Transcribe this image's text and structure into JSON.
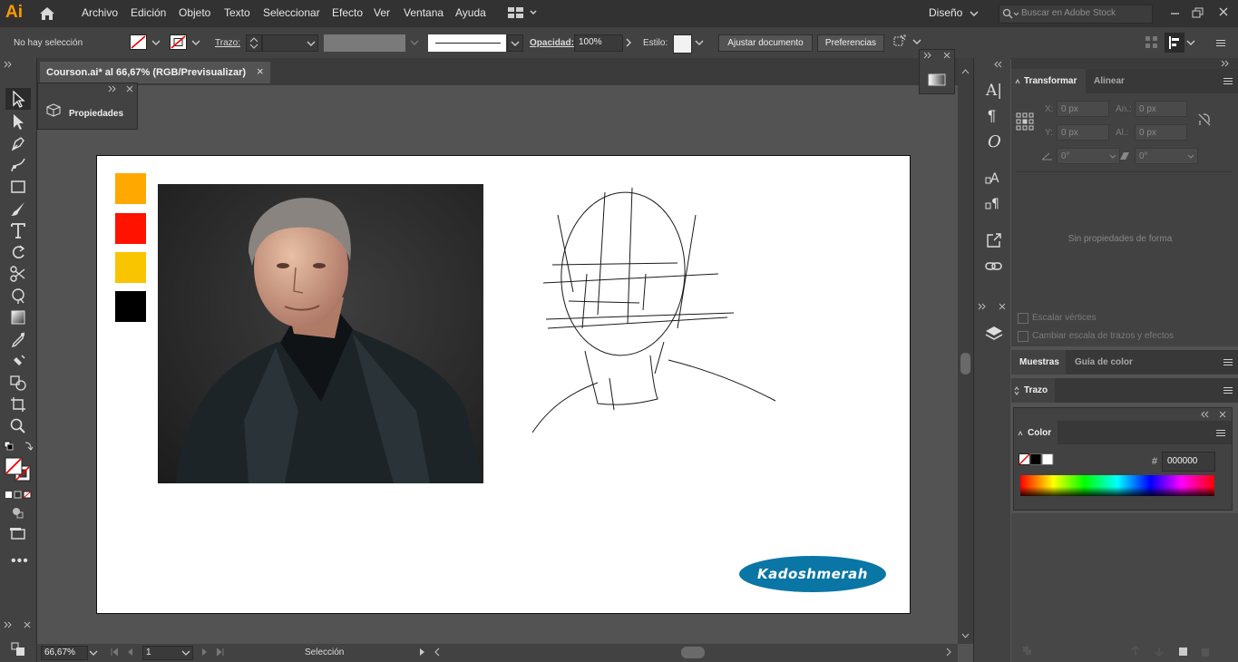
{
  "app": {
    "logo": "Ai",
    "menu": [
      "Archivo",
      "Edición",
      "Objeto",
      "Texto",
      "Seleccionar",
      "Efecto",
      "Ver",
      "Ventana",
      "Ayuda"
    ],
    "workspace": "Diseño",
    "stock_search_placeholder": "Buscar en Adobe Stock"
  },
  "control_bar": {
    "selection_status": "No hay selección",
    "stroke_label": "Trazo:",
    "opacity_label": "Opacidad:",
    "opacity_value": "100%",
    "style_label": "Estilo:",
    "fit_document_button": "Ajustar documento",
    "preferences_button": "Preferencias"
  },
  "document": {
    "tab_title": "Courson.ai* al 66,67% (RGB/Previsualizar)",
    "close_glyph": "×",
    "properties_label": "Propiedades"
  },
  "artwork": {
    "color_swatches": [
      "#ffa800",
      "#ff1200",
      "#f9c400",
      "#000000"
    ],
    "signature_text": "Kadoshmerah",
    "signature_color": "#0a76a5"
  },
  "status_bar": {
    "zoom": "66,67%",
    "artboard_number": "1",
    "current_tool": "Selección"
  },
  "right_panels": {
    "transform_tab": "Transformar",
    "align_tab": "Alinear",
    "x_label": "X:",
    "y_label": "Y:",
    "width_label": "An.:",
    "height_label": "Al.:",
    "zero_px": "0 px",
    "zero_deg": "0°",
    "no_shape_properties": "Sin propiedades de forma",
    "scale_corners": "Escalar vértices",
    "scale_strokes_effects": "Cambiar escala de trazos y efectos",
    "swatches_tab": "Muestras",
    "color_guide_tab": "Guía de color",
    "stroke_tab": "Trazo",
    "color_tab": "Color",
    "hex_label": "#",
    "hex_value": "000000"
  }
}
